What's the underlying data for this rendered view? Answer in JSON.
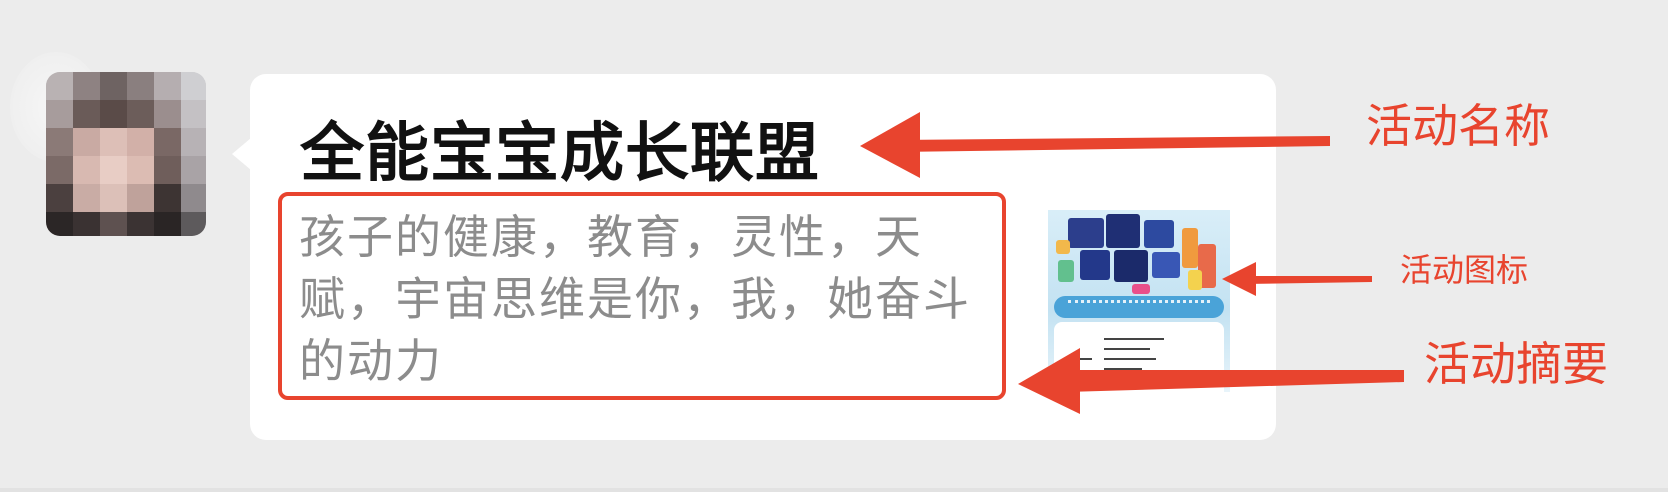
{
  "message": {
    "card_title": "全能宝宝成长联盟",
    "card_summary": "孩子的健康，教育，灵性，天赋，宇宙思维是你，我，她奋斗的动力"
  },
  "annotations": {
    "activity_name": "活动名称",
    "activity_icon": "活动图标",
    "activity_summary": "活动摘要"
  },
  "colors": {
    "background": "#ececec",
    "bubble": "#ffffff",
    "annotation_red": "#e8442e",
    "title_text": "#111111",
    "summary_text": "#8c8c8c"
  },
  "icons": {
    "avatar": "pixelated-avatar",
    "thumbnail": "activity-thumbnail-image"
  }
}
